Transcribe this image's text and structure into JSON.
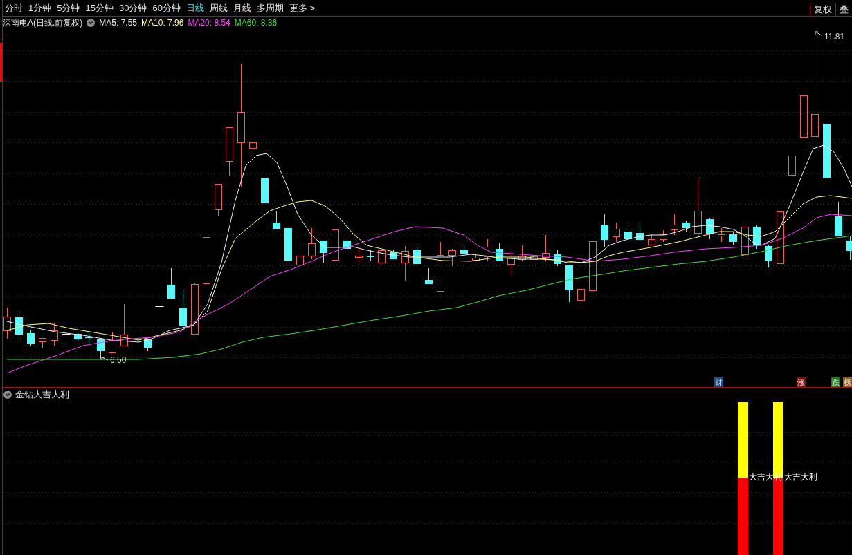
{
  "toolbar": {
    "periods": [
      {
        "label": "分时",
        "selected": false
      },
      {
        "label": "1分钟",
        "selected": false
      },
      {
        "label": "5分钟",
        "selected": false
      },
      {
        "label": "15分钟",
        "selected": false
      },
      {
        "label": "30分钟",
        "selected": false
      },
      {
        "label": "60分钟",
        "selected": false
      },
      {
        "label": "日线",
        "selected": true
      },
      {
        "label": "周线",
        "selected": false
      },
      {
        "label": "月线",
        "selected": false
      },
      {
        "label": "多周期",
        "selected": false
      }
    ],
    "more_menu": "更多 >",
    "right_buttons": [
      "复权",
      "叠"
    ]
  },
  "chart_header": {
    "title": "深南电A(日线.前复权)",
    "averages": [
      {
        "label": "MA5: 7.55",
        "color": "#f0f0f0"
      },
      {
        "label": "MA10: 7.96",
        "color": "#ffff80"
      },
      {
        "label": "MA20: 8.54",
        "color": "#ff40ff"
      },
      {
        "label": "MA60: 8.36",
        "color": "#40dd40"
      }
    ]
  },
  "price_chart": {
    "high_label": "11.81",
    "low_label": "6.50",
    "events": [
      {
        "label": "财",
        "color": "#1d4d85"
      },
      {
        "label": "涨",
        "color": "#7d1111"
      },
      {
        "label": "跌",
        "color": "#1f7a1f"
      },
      {
        "label": "榜",
        "color": "#8b5a2b"
      }
    ]
  },
  "indicator": {
    "title": "金钻大吉大利",
    "signals": [
      {
        "label": "大吉大利"
      },
      {
        "label": "大吉大利"
      }
    ]
  }
}
